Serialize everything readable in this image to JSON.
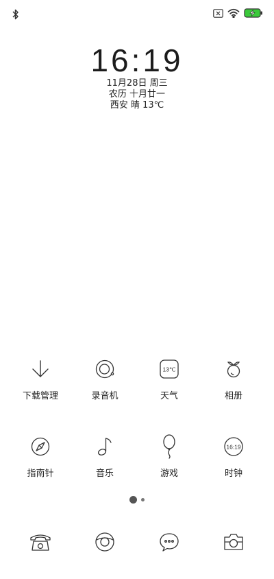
{
  "clock": {
    "time": "16:19",
    "date": "11月28日 周三",
    "lunar": "农历 十月廿一",
    "weather": "西安 晴 13℃"
  },
  "status": {
    "icons": [
      "bluetooth-icon",
      "no-sim-icon",
      "wifi-icon",
      "battery-charging-icon"
    ],
    "battery_color": "#3ac93a"
  },
  "apps": {
    "row1": [
      {
        "label": "下载管理",
        "icon": "download-icon"
      },
      {
        "label": "录音机",
        "icon": "recorder-icon"
      },
      {
        "label": "天气",
        "icon": "weather-icon",
        "icon_text": "13℃"
      },
      {
        "label": "相册",
        "icon": "gallery-icon"
      }
    ],
    "row2": [
      {
        "label": "指南针",
        "icon": "compass-icon"
      },
      {
        "label": "音乐",
        "icon": "music-icon"
      },
      {
        "label": "游戏",
        "icon": "balloon-icon"
      },
      {
        "label": "时钟",
        "icon": "clock-icon",
        "icon_text": "16:19"
      }
    ]
  },
  "pages": {
    "count": 2,
    "active": 1
  },
  "dock": [
    "phone-icon",
    "browser-icon",
    "messages-icon",
    "camera-icon"
  ]
}
